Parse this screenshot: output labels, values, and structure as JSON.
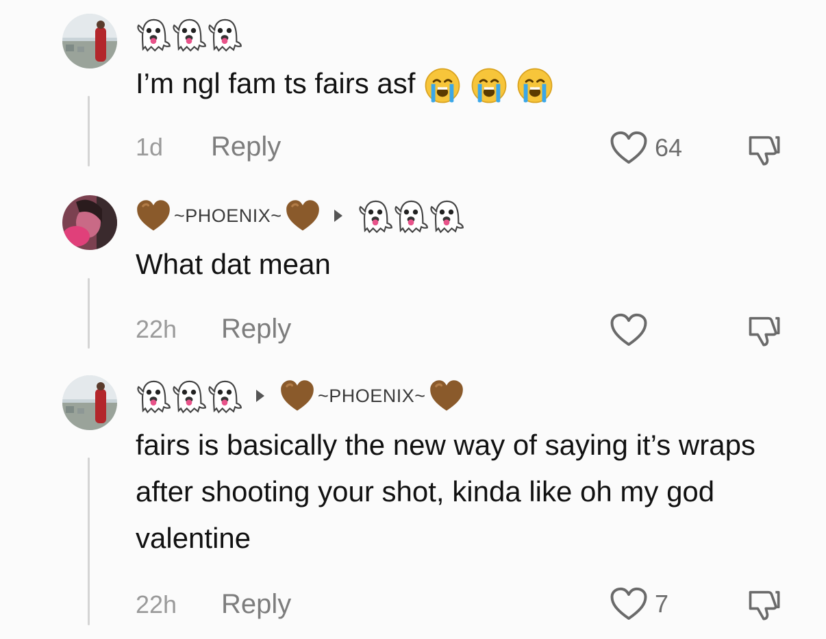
{
  "comments": [
    {
      "username_emoji": [
        "ghost",
        "ghost",
        "ghost"
      ],
      "text": "I’m ngl fam ts fairs asf",
      "trailing_emoji": [
        "loudly-crying-face",
        "loudly-crying-face",
        "loudly-crying-face"
      ],
      "time": "1d",
      "reply_label": "Reply",
      "likes": "64"
    },
    {
      "username": "~PHOENIX~",
      "reply_to_emoji": [
        "ghost",
        "ghost",
        "ghost"
      ],
      "text": "What dat mean",
      "time": "22h",
      "reply_label": "Reply",
      "likes": ""
    },
    {
      "username_emoji": [
        "ghost",
        "ghost",
        "ghost"
      ],
      "reply_to": "~PHOENIX~",
      "text": "fairs is basically the new way of saying it’s wraps after shooting your shot, kinda like oh my god valentine",
      "time": "22h",
      "reply_label": "Reply",
      "likes": "7"
    }
  ],
  "colors": {
    "heart_brown": "#8a5a2b",
    "ghost_tongue": "#e8538a",
    "cry_face": "#f7c53a",
    "tears": "#3ba7e8"
  }
}
